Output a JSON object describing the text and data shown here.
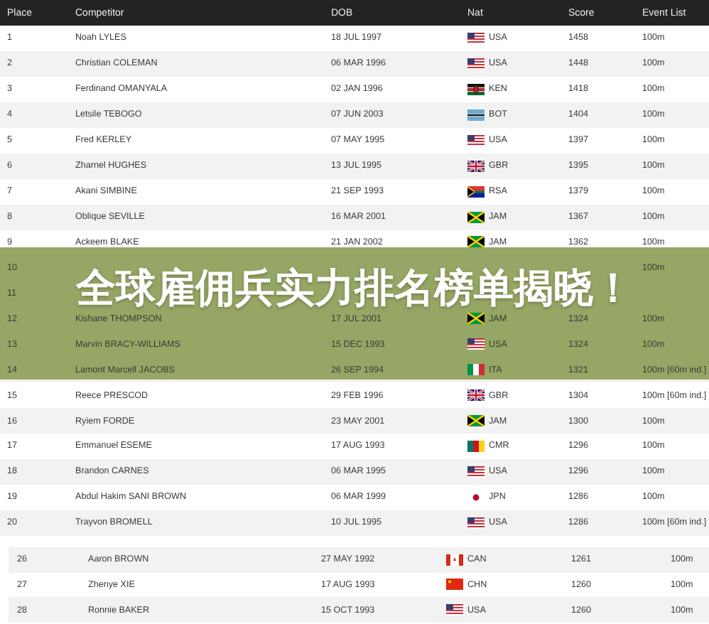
{
  "table": {
    "columns": [
      "Place",
      "Competitor",
      "DOB",
      "Nat",
      "Score",
      "Event List"
    ],
    "rows": [
      {
        "place": "1",
        "competitor": "Noah LYLES",
        "dob": "18 JUL 1997",
        "kind": "us",
        "nat": "USA",
        "score": "1458",
        "events": "100m"
      },
      {
        "place": "2",
        "competitor": "Christian COLEMAN",
        "dob": "06 MAR 1996",
        "kind": "us",
        "nat": "USA",
        "score": "1448",
        "events": "100m"
      },
      {
        "place": "3",
        "competitor": "Ferdinand OMANYALA",
        "dob": "02 JAN 1996",
        "kind": "ke",
        "nat": "KEN",
        "score": "1418",
        "events": "100m"
      },
      {
        "place": "4",
        "competitor": "Letsile TEBOGO",
        "dob": "07 JUN 2003",
        "kind": "bw",
        "nat": "BOT",
        "score": "1404",
        "events": "100m"
      },
      {
        "place": "5",
        "competitor": "Fred KERLEY",
        "dob": "07 MAY 1995",
        "kind": "us",
        "nat": "USA",
        "score": "1397",
        "events": "100m"
      },
      {
        "place": "6",
        "competitor": "Zharnel HUGHES",
        "dob": "13 JUL 1995",
        "kind": "gb",
        "nat": "GBR",
        "score": "1395",
        "events": "100m"
      },
      {
        "place": "7",
        "competitor": "Akani SIMBINE",
        "dob": "21 SEP 1993",
        "kind": "za",
        "nat": "RSA",
        "score": "1379",
        "events": "100m"
      },
      {
        "place": "8",
        "competitor": "Oblique SEVILLE",
        "dob": "16 MAR 2001",
        "kind": "jm",
        "nat": "JAM",
        "score": "1367",
        "events": "100m"
      },
      {
        "place": "9",
        "competitor": "Ackeem BLAKE",
        "dob": "21 JAN 2002",
        "kind": "jm",
        "nat": "JAM",
        "score": "1362",
        "events": "100m"
      },
      {
        "place": "10",
        "events": "100m"
      },
      {
        "place": "11"
      },
      {
        "place": "12",
        "competitor": "Kishane THOMPSON",
        "dob": "17 JUL 2001",
        "kind": "jm",
        "nat": "JAM",
        "score": "1324",
        "events": "100m"
      },
      {
        "place": "13",
        "competitor": "Marvin BRACY-WILLIAMS",
        "dob": "15 DEC 1993",
        "kind": "us",
        "nat": "USA",
        "score": "1324",
        "events": "100m"
      },
      {
        "place": "14",
        "competitor": "Lamont Marcell JACOBS",
        "dob": "26 SEP 1994",
        "kind": "it",
        "nat": "ITA",
        "score": "1321",
        "events": "100m [60m ind.]"
      },
      {
        "place": "15",
        "competitor": "Reece PRESCOD",
        "dob": "29 FEB 1996",
        "kind": "gb",
        "nat": "GBR",
        "score": "1304",
        "events": "100m [60m ind.]"
      },
      {
        "place": "16",
        "competitor": "Ryiem FORDE",
        "dob": "23 MAY 2001",
        "kind": "jm",
        "nat": "JAM",
        "score": "1300",
        "events": "100m"
      },
      {
        "place": "17",
        "competitor": "Emmanuel ESEME",
        "dob": "17 AUG 1993",
        "kind": "cm",
        "nat": "CMR",
        "score": "1296",
        "events": "100m"
      },
      {
        "place": "18",
        "competitor": "Brandon CARNES",
        "dob": "06 MAR 1995",
        "kind": "us",
        "nat": "USA",
        "score": "1296",
        "events": "100m"
      },
      {
        "place": "19",
        "competitor": "Abdul Hakim SANI BROWN",
        "dob": "06 MAR 1999",
        "kind": "jp",
        "nat": "JPN",
        "score": "1286",
        "events": "100m"
      },
      {
        "place": "20",
        "competitor": "Trayvon BROMELL",
        "dob": "10 JUL 1995",
        "kind": "us",
        "nat": "USA",
        "score": "1286",
        "events": "100m [60m ind.]"
      }
    ]
  },
  "table_continued": {
    "rows": [
      {
        "place": "26",
        "competitor": "Aaron BROWN",
        "dob": "27 MAY 1992",
        "kind": "ca",
        "nat": "CAN",
        "score": "1261",
        "events": "100m"
      },
      {
        "place": "27",
        "competitor": "Zhenye XIE",
        "dob": "17 AUG 1993",
        "kind": "cn",
        "nat": "CHN",
        "score": "1260",
        "events": "100m"
      },
      {
        "place": "28",
        "competitor": "Ronnie BAKER",
        "dob": "15 OCT 1993",
        "kind": "us",
        "nat": "USA",
        "score": "1260",
        "events": "100m"
      }
    ]
  },
  "banner": {
    "title": "全球雇佣兵实力排名榜单揭晓！"
  }
}
